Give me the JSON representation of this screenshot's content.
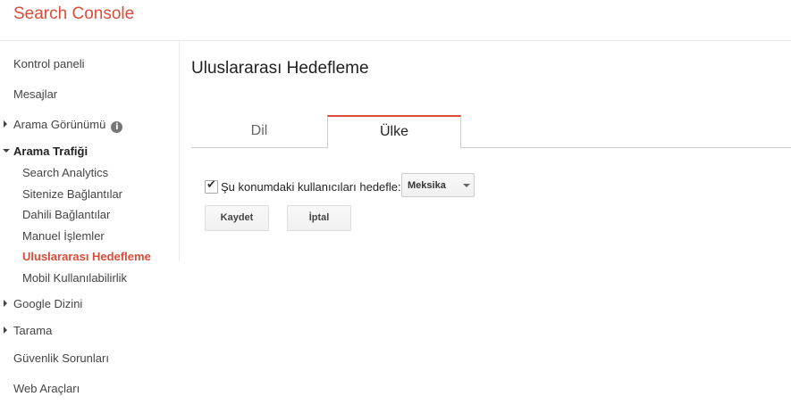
{
  "app": {
    "title": "Search Console"
  },
  "sidebar": {
    "items": [
      {
        "label": "Kontrol paneli"
      },
      {
        "label": "Mesajlar"
      },
      {
        "label": "Arama Görünümü"
      },
      {
        "label": "Arama Trafiği"
      },
      {
        "label": "Google Dizini"
      },
      {
        "label": "Tarama"
      },
      {
        "label": "Güvenlik Sorunları"
      },
      {
        "label": "Web Araçları"
      }
    ],
    "traffic_sub": [
      {
        "label": "Search Analytics"
      },
      {
        "label": "Sitenize Bağlantılar"
      },
      {
        "label": "Dahili Bağlantılar"
      },
      {
        "label": "Manuel İşlemler"
      },
      {
        "label": "Uluslararası Hedefleme"
      },
      {
        "label": "Mobil Kullanılabilirlik"
      }
    ],
    "info_glyph": "i"
  },
  "main": {
    "title": "Uluslararası Hedefleme",
    "tabs": [
      {
        "label": "Dil"
      },
      {
        "label": "Ülke"
      }
    ],
    "active_tab": "Ülke",
    "target": {
      "checked": true,
      "label": "Şu konumdaki kullanıcıları hedefle:",
      "country": "Meksika"
    },
    "buttons": {
      "save": "Kaydet",
      "cancel": "İptal"
    }
  },
  "colors": {
    "accent": "#dd4b39"
  }
}
